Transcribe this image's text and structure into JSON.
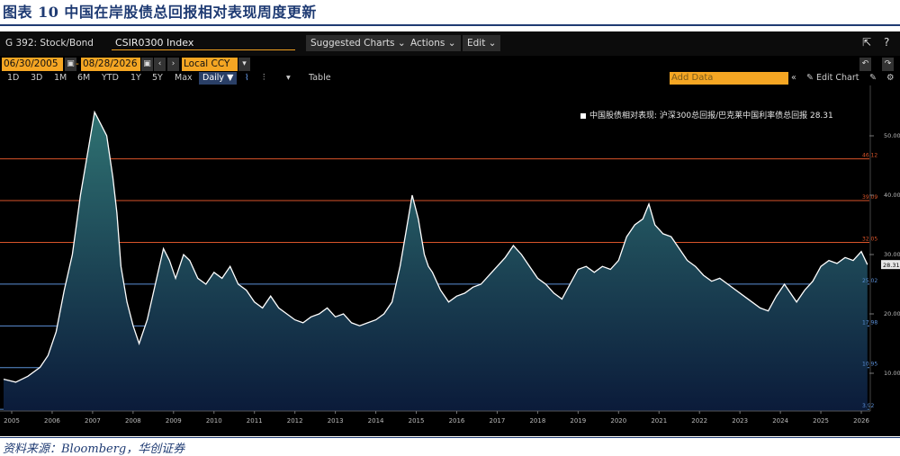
{
  "figure_title": "图表 10  中国在岸股债总回报相对表现周度更新",
  "source": "资料来源：Bloomberg，华创证券",
  "terminal": {
    "ticker": "G 392: Stock/Bond",
    "security_field": "CSIR0300 Index",
    "menus": [
      "Suggested Charts",
      "Actions",
      "Edit"
    ],
    "date_start": "06/30/2005",
    "date_end": "08/28/2026",
    "currency": "Local CCY",
    "periods": [
      "1D",
      "3D",
      "1M",
      "6M",
      "YTD",
      "1Y",
      "5Y",
      "Max"
    ],
    "frequency": "Daily",
    "table_label": "Table",
    "add_data_placeholder": "Add Data",
    "edit_chart_label": "Edit Chart"
  },
  "colors": {
    "line": "#ffffff",
    "area_top": "#2f7272",
    "area_bottom": "#0b1b3a",
    "orange_line": "#d9542a",
    "blue_line": "#5b8fd6",
    "background": "#000000"
  },
  "chart_data": {
    "type": "area",
    "title": "",
    "legend_entry": "中国股债相对表现: 沪深300总回报/巴克莱中国利率债总回报 28.31",
    "last_value_label": "28.31",
    "ylim": [
      0,
      60
    ],
    "y_ticks": [
      "10.00",
      "20.00",
      "30.00",
      "40.00",
      "50.00"
    ],
    "x_ticks": [
      "2005",
      "2006",
      "2007",
      "2008",
      "2009",
      "2010",
      "2011",
      "2012",
      "2013",
      "2014",
      "2015",
      "2016",
      "2017",
      "2018",
      "2019",
      "2020",
      "2021",
      "2022",
      "2023",
      "2024",
      "2025",
      "2026"
    ],
    "reference_lines": [
      {
        "value": 46.12,
        "label": "46.12",
        "color": "orange"
      },
      {
        "value": 39.09,
        "label": "39.09",
        "color": "orange"
      },
      {
        "value": 32.05,
        "label": "32.05",
        "color": "orange"
      },
      {
        "value": 25.02,
        "label": "25.02",
        "color": "blue"
      },
      {
        "value": 17.98,
        "label": "17.98",
        "color": "blue"
      },
      {
        "value": 10.95,
        "label": "10.95",
        "color": "blue"
      },
      {
        "value": 3.92,
        "label": "3.92",
        "color": "blue"
      }
    ],
    "series": [
      {
        "x": [
          2005.0,
          2005.3,
          2005.6,
          2005.9,
          2006.1,
          2006.3,
          2006.5,
          2006.7,
          2006.9,
          2007.1,
          2007.25,
          2007.4,
          2007.55,
          2007.7,
          2007.8,
          2007.9,
          2008.05,
          2008.2,
          2008.35,
          2008.55,
          2008.75,
          2008.95,
          2009.1,
          2009.25,
          2009.45,
          2009.6,
          2009.8,
          2010.0,
          2010.2,
          2010.4,
          2010.6,
          2010.8,
          2011.0,
          2011.2,
          2011.4,
          2011.6,
          2011.8,
          2012.0,
          2012.2,
          2012.4,
          2012.6,
          2012.8,
          2013.0,
          2013.2,
          2013.4,
          2013.6,
          2013.8,
          2014.0,
          2014.2,
          2014.4,
          2014.6,
          2014.8,
          2014.95,
          2015.1,
          2015.25,
          2015.4,
          2015.5,
          2015.6,
          2015.8,
          2016.0,
          2016.2,
          2016.4,
          2016.6,
          2016.8,
          2017.0,
          2017.2,
          2017.4,
          2017.6,
          2017.8,
          2018.0,
          2018.2,
          2018.4,
          2018.6,
          2018.8,
          2019.0,
          2019.2,
          2019.4,
          2019.6,
          2019.8,
          2020.0,
          2020.2,
          2020.4,
          2020.6,
          2020.8,
          2020.95,
          2021.1,
          2021.3,
          2021.5,
          2021.7,
          2021.9,
          2022.1,
          2022.3,
          2022.5,
          2022.7,
          2022.9,
          2023.1,
          2023.3,
          2023.5,
          2023.7,
          2023.9,
          2024.1,
          2024.3,
          2024.4,
          2024.6,
          2024.8,
          2025.0,
          2025.2,
          2025.4,
          2025.6,
          2025.8,
          2026.0,
          2026.2,
          2026.35
        ],
        "values": [
          9.0,
          8.5,
          9.5,
          11.0,
          13.0,
          17.0,
          24.0,
          30.0,
          40.0,
          48.0,
          54.0,
          52.0,
          50.0,
          43.0,
          37.0,
          28.0,
          22.0,
          18.0,
          15.0,
          19.0,
          25.0,
          31.0,
          29.0,
          26.0,
          30.0,
          29.0,
          26.0,
          25.0,
          27.0,
          26.0,
          28.0,
          25.0,
          24.0,
          22.0,
          21.0,
          23.0,
          21.0,
          20.0,
          19.0,
          18.5,
          19.5,
          20.0,
          21.0,
          19.5,
          20.0,
          18.5,
          18.0,
          18.5,
          19.0,
          20.0,
          22.0,
          28.0,
          34.0,
          40.0,
          36.0,
          30.0,
          28.0,
          27.0,
          24.0,
          22.0,
          23.0,
          23.5,
          24.5,
          25.0,
          26.5,
          28.0,
          29.5,
          31.5,
          30.0,
          28.0,
          26.0,
          25.0,
          23.5,
          22.5,
          25.0,
          27.5,
          28.0,
          27.0,
          28.0,
          27.5,
          29.0,
          33.0,
          35.0,
          36.0,
          38.5,
          35.0,
          33.5,
          33.0,
          31.0,
          29.0,
          28.0,
          26.5,
          25.5,
          26.0,
          25.0,
          24.0,
          23.0,
          22.0,
          21.0,
          20.5,
          23.0,
          25.0,
          24.0,
          22.0,
          24.0,
          25.5,
          28.0,
          29.0,
          28.5,
          29.5,
          29.0,
          30.5,
          28.31
        ]
      }
    ]
  }
}
